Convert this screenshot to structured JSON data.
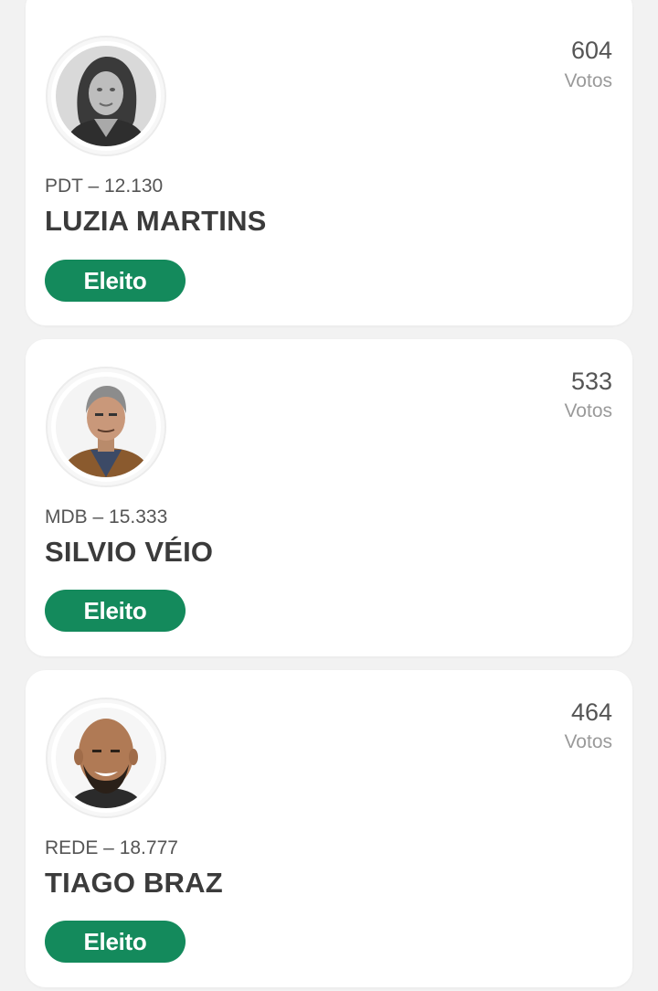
{
  "candidates": [
    {
      "photo": "portrait-woman-grayscale",
      "votes": "604",
      "votes_label": "Votos",
      "party": "PDT – 12.130",
      "name": "LUZIA MARTINS",
      "status": "Eleito"
    },
    {
      "photo": "portrait-man-gray-hair",
      "votes": "533",
      "votes_label": "Votos",
      "party": "MDB – 15.333",
      "name": "SILVIO VÉIO",
      "status": "Eleito"
    },
    {
      "photo": "portrait-man-bald-smiling",
      "votes": "464",
      "votes_label": "Votos",
      "party": "REDE – 18.777",
      "name": "TIAGO BRAZ",
      "status": "Eleito"
    }
  ],
  "colors": {
    "badge": "#148a5c",
    "page_background": "#f2f2f2",
    "card_background": "#ffffff"
  }
}
